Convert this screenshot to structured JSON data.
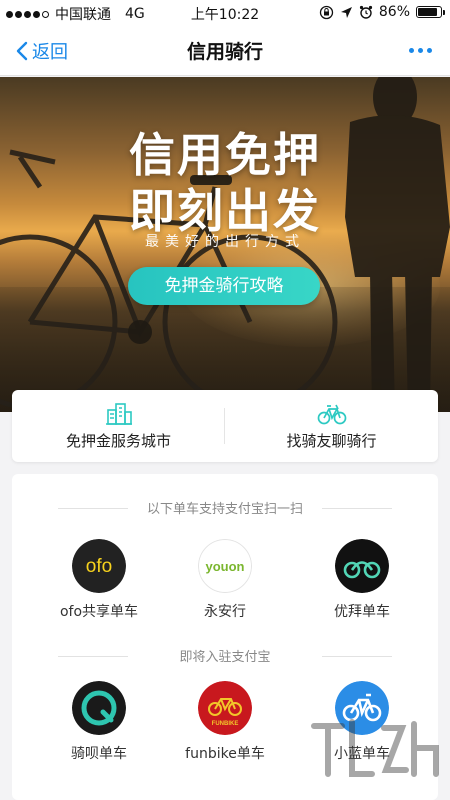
{
  "status_bar": {
    "carrier": "中国联通",
    "network": "4G",
    "time": "上午10:22",
    "battery": "86%",
    "battery_level": 0.86,
    "signal_bars": 4,
    "signal_max": 5
  },
  "nav": {
    "back_label": "返回",
    "title": "信用骑行"
  },
  "banner": {
    "title_line1": "信用免押",
    "title_line2": "即刻出发",
    "subtitle": "最美好的出行方式",
    "button_label": "免押金骑行攻略"
  },
  "quick_links": [
    {
      "label": "免押金服务城市",
      "icon": "city-buildings-icon"
    },
    {
      "label": "找骑友聊骑行",
      "icon": "bicycle-icon"
    }
  ],
  "sections": {
    "supported": {
      "title": "以下单车支持支付宝扫一扫",
      "bikes": [
        {
          "name": "ofo共享单车",
          "logo_text": "ofo",
          "color": "#222222"
        },
        {
          "name": "永安行",
          "logo_text": "youon",
          "color": "#7ab62e"
        },
        {
          "name": "优拜单车",
          "logo_text": "",
          "color": "#111111"
        }
      ]
    },
    "coming": {
      "title": "即将入驻支付宝",
      "bikes": [
        {
          "name": "骑呗单车",
          "logo_text": "",
          "color": "#1a1a1a"
        },
        {
          "name": "funbike单车",
          "logo_text": "FUNBIKE",
          "color": "#c8181e"
        },
        {
          "name": "小蓝单车",
          "logo_text": "",
          "color": "#2b8de6"
        }
      ]
    }
  },
  "colors": {
    "accent_blue": "#1a88e8",
    "teal_button": "#2cc9c2",
    "ofo_yellow": "#f7d21d",
    "ubike_teal": "#52d6b6",
    "qibei_teal": "#2ec6b0",
    "funbike_red": "#c8181e",
    "bluegogo_blue": "#2b8de6"
  }
}
